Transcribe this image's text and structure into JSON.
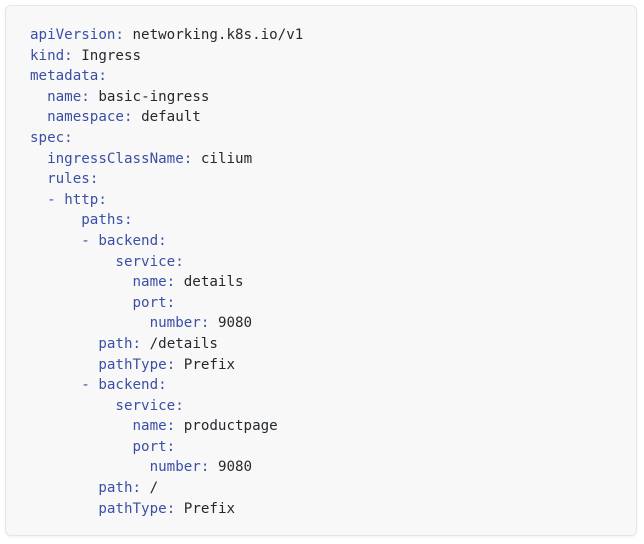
{
  "code_block": {
    "language": "yaml",
    "colors": {
      "key": "#3a4fa6",
      "value": "#24292e",
      "background": "#f8f8f8"
    },
    "lines": [
      {
        "indent": 0,
        "dash": "",
        "key": "apiVersion",
        "value": "networking.k8s.io/v1"
      },
      {
        "indent": 0,
        "dash": "",
        "key": "kind",
        "value": "Ingress"
      },
      {
        "indent": 0,
        "dash": "",
        "key": "metadata",
        "value": ""
      },
      {
        "indent": 2,
        "dash": "",
        "key": "name",
        "value": "basic-ingress"
      },
      {
        "indent": 2,
        "dash": "",
        "key": "namespace",
        "value": "default"
      },
      {
        "indent": 0,
        "dash": "",
        "key": "spec",
        "value": ""
      },
      {
        "indent": 2,
        "dash": "",
        "key": "ingressClassName",
        "value": "cilium"
      },
      {
        "indent": 2,
        "dash": "",
        "key": "rules",
        "value": ""
      },
      {
        "indent": 2,
        "dash": "- ",
        "key": "http",
        "value": ""
      },
      {
        "indent": 6,
        "dash": "",
        "key": "paths",
        "value": ""
      },
      {
        "indent": 6,
        "dash": "- ",
        "key": "backend",
        "value": ""
      },
      {
        "indent": 10,
        "dash": "",
        "key": "service",
        "value": ""
      },
      {
        "indent": 12,
        "dash": "",
        "key": "name",
        "value": "details"
      },
      {
        "indent": 12,
        "dash": "",
        "key": "port",
        "value": ""
      },
      {
        "indent": 14,
        "dash": "",
        "key": "number",
        "value": "9080"
      },
      {
        "indent": 8,
        "dash": "",
        "key": "path",
        "value": "/details"
      },
      {
        "indent": 8,
        "dash": "",
        "key": "pathType",
        "value": "Prefix"
      },
      {
        "indent": 6,
        "dash": "- ",
        "key": "backend",
        "value": ""
      },
      {
        "indent": 10,
        "dash": "",
        "key": "service",
        "value": ""
      },
      {
        "indent": 12,
        "dash": "",
        "key": "name",
        "value": "productpage"
      },
      {
        "indent": 12,
        "dash": "",
        "key": "port",
        "value": ""
      },
      {
        "indent": 14,
        "dash": "",
        "key": "number",
        "value": "9080"
      },
      {
        "indent": 8,
        "dash": "",
        "key": "path",
        "value": "/"
      },
      {
        "indent": 8,
        "dash": "",
        "key": "pathType",
        "value": "Prefix"
      }
    ]
  }
}
